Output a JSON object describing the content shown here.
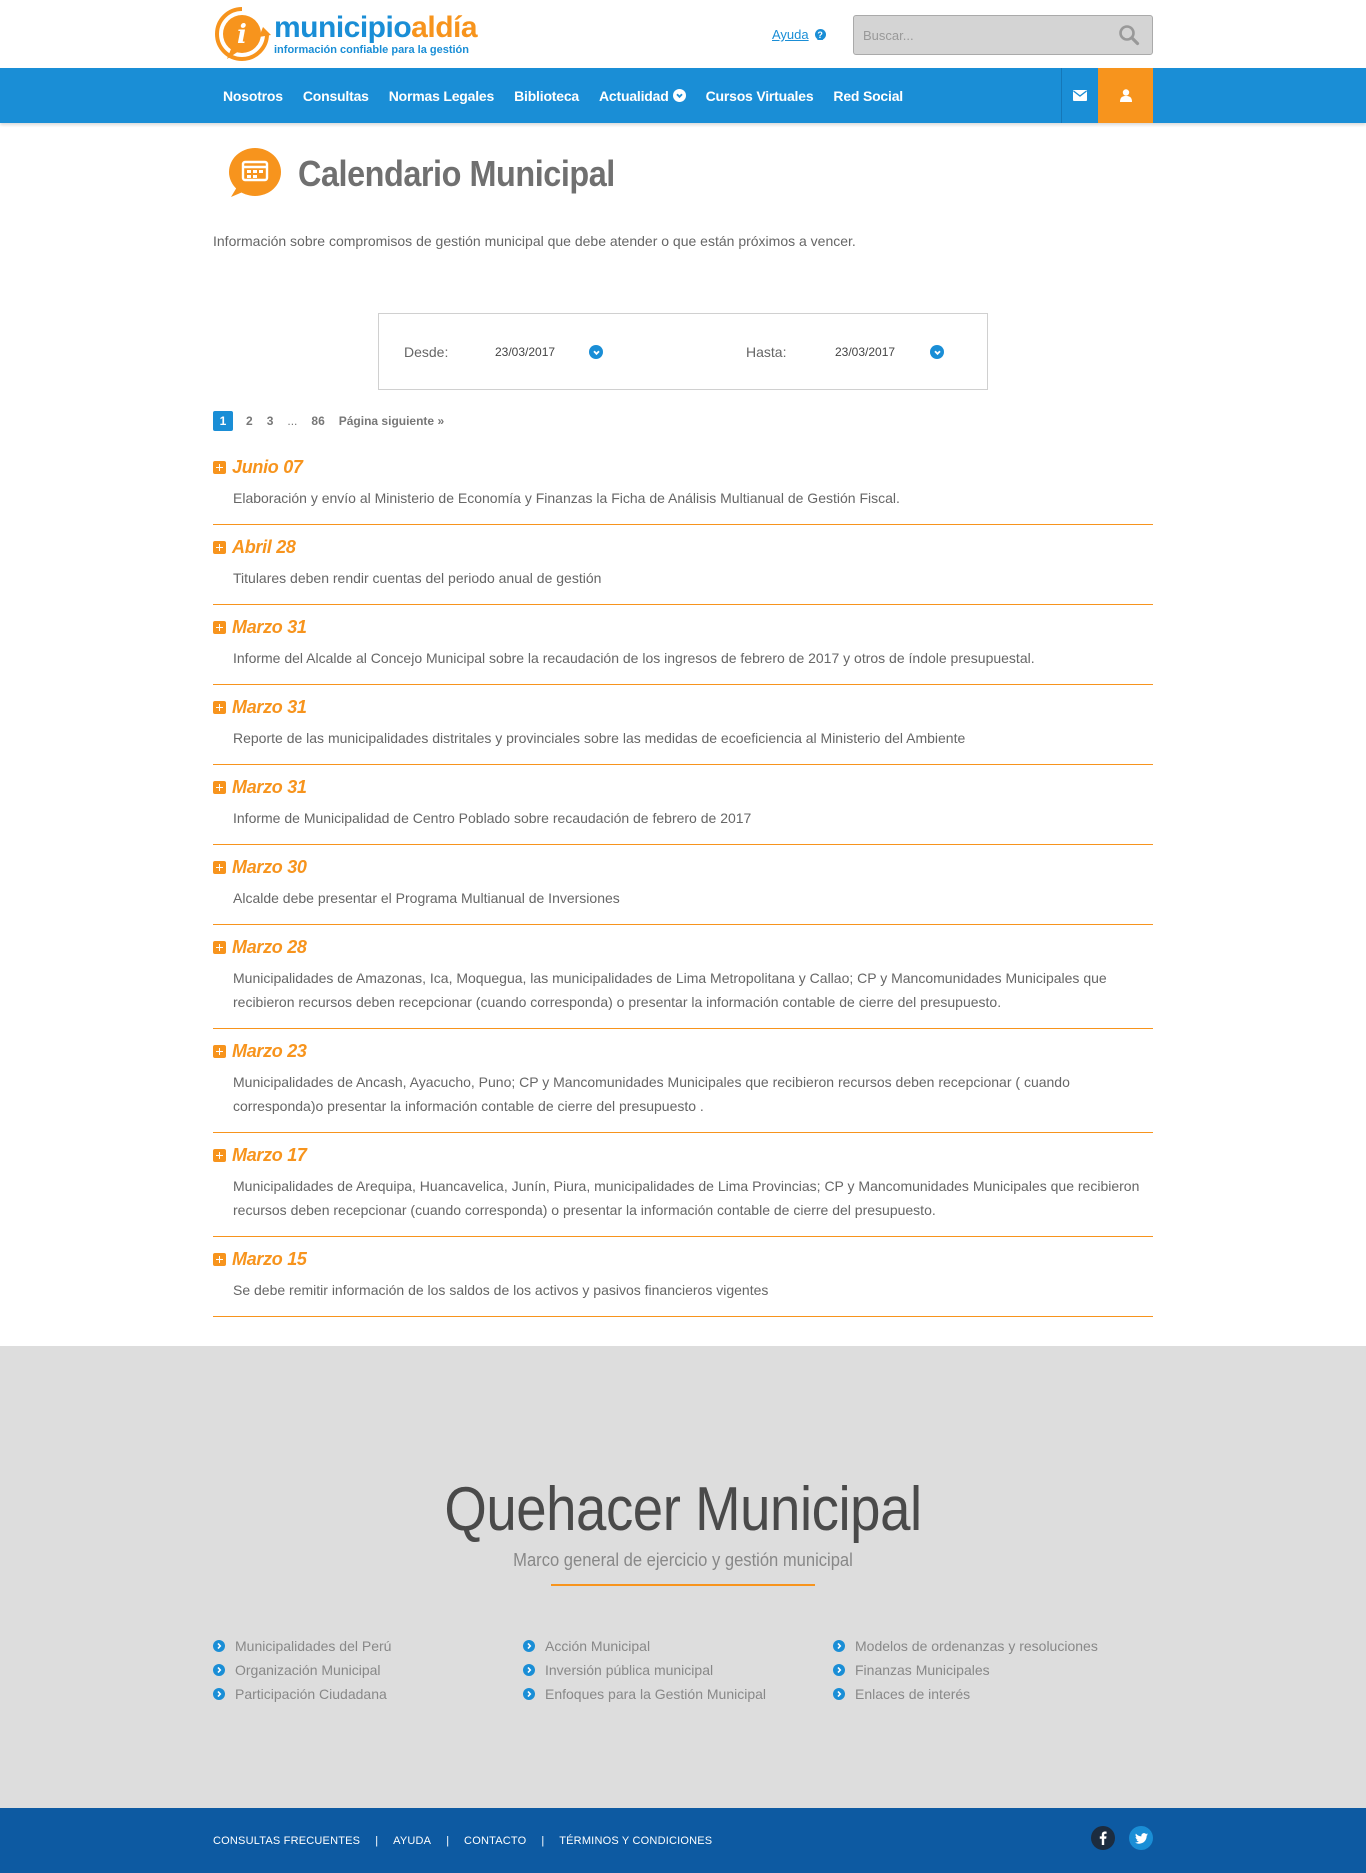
{
  "brand": {
    "name_part1": "municipio",
    "name_part2": "aldía",
    "tagline": "información confiable para la gestión",
    "primary_color": "#1a8ed6",
    "accent_color": "#f7941d"
  },
  "header": {
    "help_label": "Ayuda",
    "search_placeholder": "Buscar..."
  },
  "nav": {
    "items": [
      {
        "label": "Nosotros"
      },
      {
        "label": "Consultas"
      },
      {
        "label": "Normas Legales"
      },
      {
        "label": "Biblioteca"
      },
      {
        "label": "Actualidad",
        "has_dropdown": true
      },
      {
        "label": "Cursos Virtuales"
      },
      {
        "label": "Red Social"
      }
    ],
    "icons": [
      "envelope-icon",
      "user-icon"
    ]
  },
  "page": {
    "title": "Calendario Municipal",
    "description": "Información sobre compromisos de gestión municipal que debe atender o que están próximos a vencer."
  },
  "filter": {
    "from_label": "Desde:",
    "from_value": "23/03/2017",
    "to_label": "Hasta:",
    "to_value": "23/03/2017"
  },
  "pagination": {
    "pages": [
      "1",
      "2",
      "3"
    ],
    "ellipsis": "...",
    "last": "86",
    "next": "Página siguiente »",
    "current": "1"
  },
  "events": [
    {
      "date": "Junio 07",
      "text": "Elaboración y envío al Ministerio de Economía y Finanzas la Ficha de Análisis Multianual de Gestión Fiscal."
    },
    {
      "date": "Abril 28",
      "text": "Titulares deben rendir cuentas del periodo anual de gestión"
    },
    {
      "date": "Marzo 31",
      "text": "Informe del Alcalde al Concejo Municipal sobre la recaudación de los ingresos de febrero de 2017 y otros de índole presupuestal."
    },
    {
      "date": "Marzo 31",
      "text": "Reporte de las municipalidades distritales y provinciales sobre las medidas de ecoeficiencia al Ministerio del Ambiente"
    },
    {
      "date": "Marzo 31",
      "text": "Informe de Municipalidad de Centro Poblado sobre recaudación de febrero de 2017"
    },
    {
      "date": "Marzo 30",
      "text": "Alcalde debe presentar el Programa Multianual de Inversiones"
    },
    {
      "date": "Marzo 28",
      "text": "Municipalidades de Amazonas, Ica, Moquegua, las municipalidades de Lima Metropolitana y Callao; CP y Mancomunidades Municipales que recibieron recursos deben recepcionar (cuando corresponda) o presentar la información contable de cierre del presupuesto."
    },
    {
      "date": "Marzo 23",
      "text": "Municipalidades de Ancash, Ayacucho, Puno; CP y Mancomunidades Municipales que recibieron recursos deben recepcionar ( cuando corresponda)o presentar la información contable de cierre del presupuesto ."
    },
    {
      "date": "Marzo 17",
      "text": "Municipalidades de Arequipa, Huancavelica, Junín, Piura, municipalidades de Lima Provincias; CP y Mancomunidades Municipales que recibieron recursos deben recepcionar (cuando corresponda) o presentar la información contable de cierre del presupuesto."
    },
    {
      "date": "Marzo 15",
      "text": "Se debe remitir información de los saldos de los activos y pasivos financieros vigentes"
    }
  ],
  "quehacer": {
    "title": "Quehacer Municipal",
    "subtitle": "Marco general de ejercicio y gestión municipal",
    "columns": [
      [
        "Municipalidades del Perú",
        "Organización Municipal",
        "Participación Ciudadana"
      ],
      [
        "Acción Municipal",
        "Inversión pública municipal",
        "Enfoques para la Gestión Municipal"
      ],
      [
        "Modelos de ordenanzas y resoluciones",
        "Finanzas Municipales",
        "Enlaces de interés"
      ]
    ]
  },
  "footer": {
    "links": [
      "CONSULTAS FRECUENTES",
      "AYUDA",
      "CONTACTO",
      "TÉRMINOS Y CONDICIONES"
    ],
    "separator": "|",
    "social": [
      "facebook-icon",
      "twitter-icon"
    ]
  }
}
